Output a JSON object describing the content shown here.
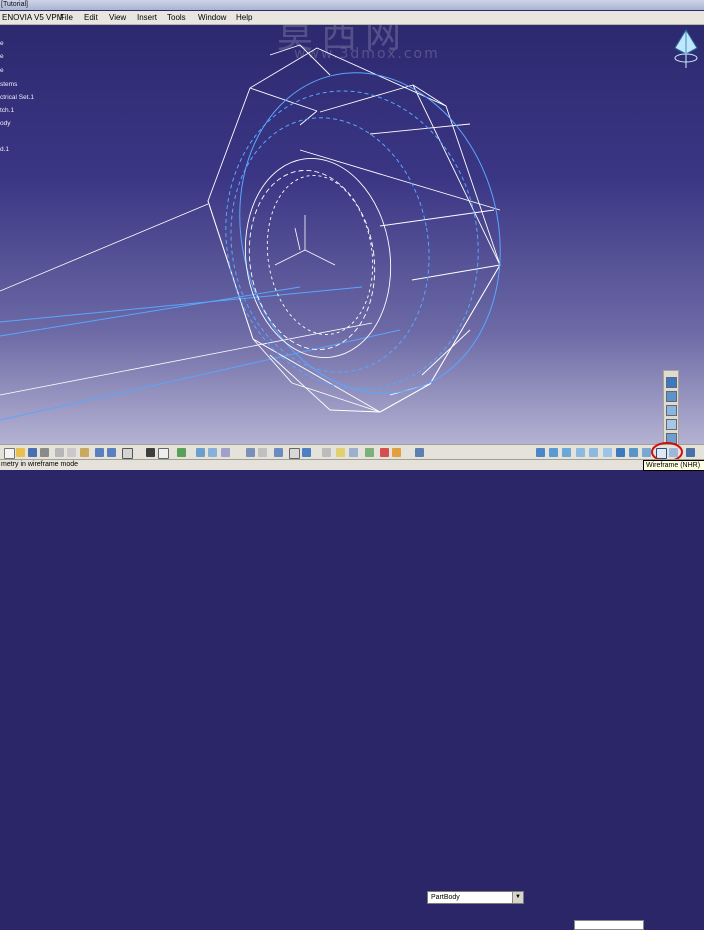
{
  "window": {
    "title": "[Tutorial]"
  },
  "menu": {
    "app_name": "ENOVIA V5 VPM",
    "items": [
      "File",
      "Edit",
      "View",
      "Insert",
      "Tools",
      "Window",
      "Help"
    ]
  },
  "tree": {
    "items": [
      "e",
      "e",
      "e",
      "stems",
      "ctrical Set.1",
      "tch.1",
      "ody",
      "d.1"
    ]
  },
  "watermark": {
    "chinese": "莫西网",
    "url": "www.3dmox.com"
  },
  "toolbar": {
    "body_select": "PartBody"
  },
  "status": {
    "message": "metry in wireframe mode"
  },
  "tooltip": {
    "text": "Wireframe (NHR)"
  },
  "colors": {
    "background_top": "#2b276c",
    "background_bottom": "#b4b2d2",
    "wire_white": "#ffffff",
    "wire_blue": "#5aa6ff",
    "highlight_circle": "#d01010"
  }
}
